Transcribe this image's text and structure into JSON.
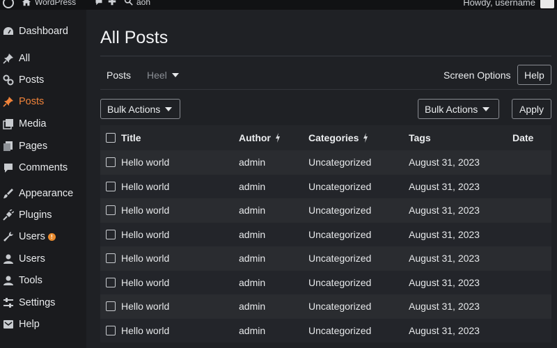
{
  "adminbar": {
    "site_name": "WordPress",
    "search_text": "aoh",
    "howdy": "Howdy, username",
    "icons": [
      "wordpress-logo-icon",
      "home-icon",
      "comment-icon",
      "new-content-icon",
      "search-icon"
    ]
  },
  "sidebar": {
    "items": [
      {
        "label": "Dashboard",
        "icon": "dashboard-icon"
      },
      {
        "label": "All",
        "icon": "pin-icon"
      },
      {
        "label": "Posts",
        "icon": "posts-icon"
      },
      {
        "label": "Posts",
        "icon": "pin-icon",
        "current": true
      },
      {
        "label": "Media",
        "icon": "media-icon"
      },
      {
        "label": "Pages",
        "icon": "pages-icon"
      },
      {
        "label": "Comments",
        "icon": "comments-icon"
      },
      {
        "label": "Appearance",
        "icon": "appearance-icon"
      },
      {
        "label": "Plugins",
        "icon": "plugins-icon"
      },
      {
        "label": "Users",
        "icon": "tools-icon",
        "badge": "!"
      },
      {
        "label": "Users",
        "icon": "users-icon"
      },
      {
        "label": "Tools",
        "icon": "user-icon"
      },
      {
        "label": "Settings",
        "icon": "settings-icon"
      },
      {
        "label": "Help",
        "icon": "help-icon"
      }
    ],
    "accent_color": "#f0833a"
  },
  "main": {
    "title": "All Posts",
    "subtabs": [
      {
        "label": "Posts"
      },
      {
        "label": "Heel"
      }
    ],
    "screen_options": "Screen Options",
    "help": "Help",
    "bulk_actions_top": "Bulk Actions",
    "bulk_actions_right": "Bulk Actions",
    "apply": "Apply"
  },
  "table": {
    "columns": [
      "Title",
      "Author",
      "Categories",
      "Tags",
      "Date"
    ],
    "rows": [
      {
        "title": "Hello world",
        "author": "admin",
        "category": "Uncategorized",
        "tags": "August 31, 2023"
      },
      {
        "title": "Hello world",
        "author": "admin",
        "category": "Uncategorized",
        "tags": "August 31, 2023"
      },
      {
        "title": "Hello world",
        "author": "admin",
        "category": "Uncategorized",
        "tags": "August 31, 2023"
      },
      {
        "title": "Hello world",
        "author": "admin",
        "category": "Uncategorized",
        "tags": "August 31, 2023"
      },
      {
        "title": "Hello world",
        "author": "admin",
        "category": "Uncategorized",
        "tags": "August 31, 2023"
      },
      {
        "title": "Hello world",
        "author": "admin",
        "category": "Uncategorized",
        "tags": "August 31, 2023"
      },
      {
        "title": "Hello world",
        "author": "admin",
        "category": "Uncategorized",
        "tags": "August 31, 2023"
      },
      {
        "title": "Hello world",
        "author": "admin",
        "category": "Uncategorized",
        "tags": "August 31, 2023"
      }
    ]
  }
}
